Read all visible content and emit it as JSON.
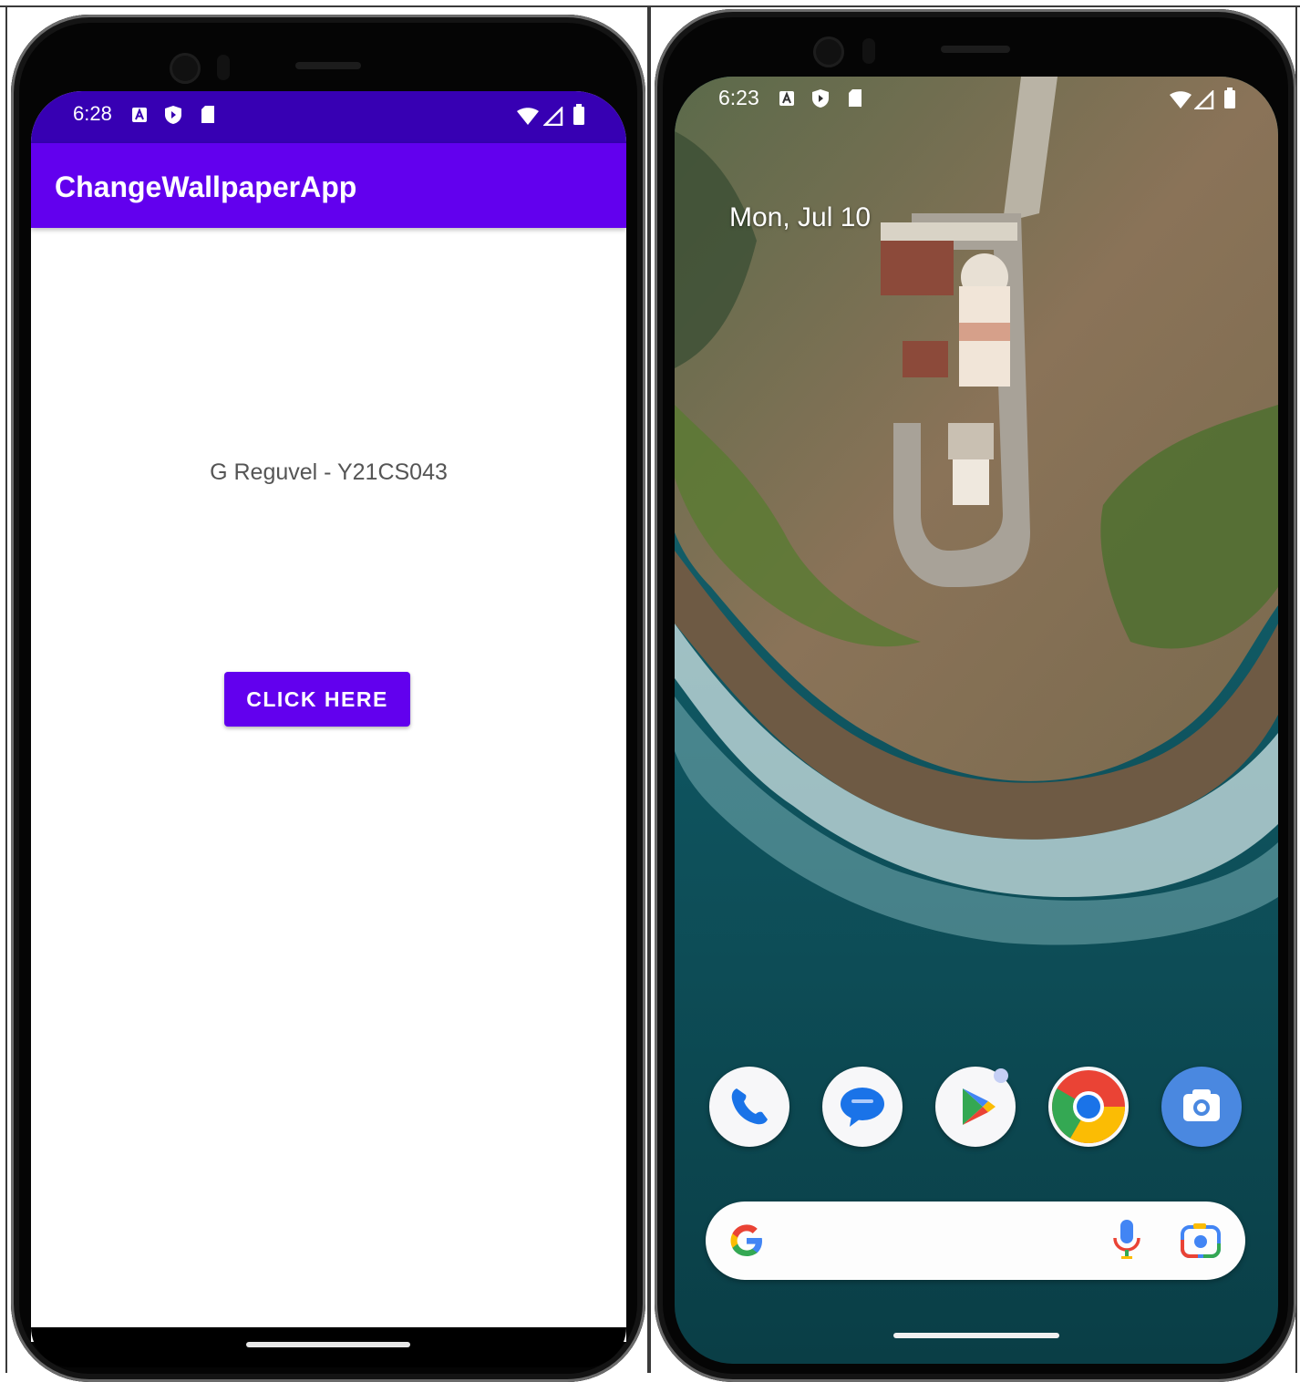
{
  "left_phone": {
    "status_bar": {
      "time": "6:28"
    },
    "app_bar": {
      "title": "ChangeWallpaperApp"
    },
    "content": {
      "name_text": "G Reguvel - Y21CS043",
      "button_label": "CLICK HERE"
    }
  },
  "right_phone": {
    "status_bar": {
      "time": "6:23"
    },
    "home_screen": {
      "date": "Mon, Jul 10",
      "dock": [
        {
          "name": "phone-app-icon"
        },
        {
          "name": "messages-app-icon"
        },
        {
          "name": "play-store-app-icon"
        },
        {
          "name": "chrome-app-icon"
        },
        {
          "name": "camera-app-icon"
        }
      ],
      "search_bar": {
        "icons": [
          "google-g-icon",
          "microphone-icon",
          "lens-icon"
        ]
      }
    }
  },
  "colors": {
    "status_bar": "#3700b3",
    "primary": "#6200ee",
    "text_secondary": "#555555"
  }
}
